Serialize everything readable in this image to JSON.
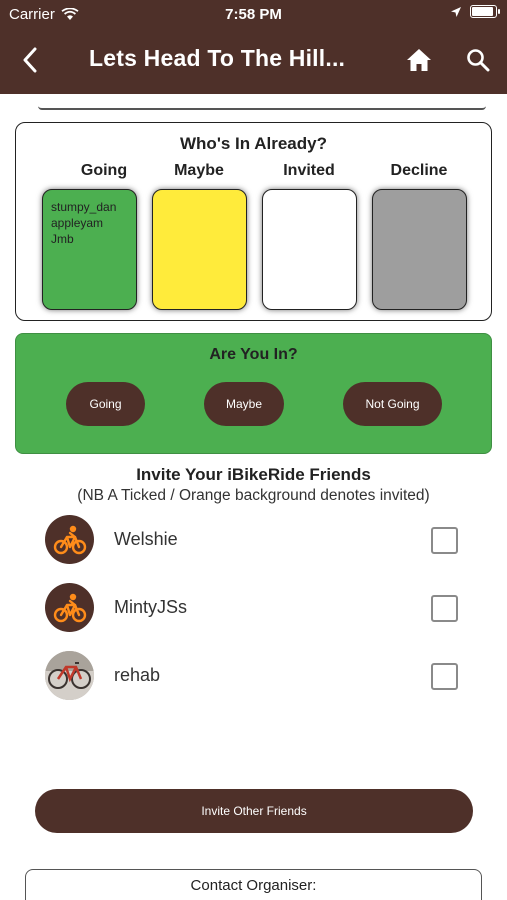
{
  "status_bar": {
    "carrier": "Carrier",
    "time": "7:58 PM"
  },
  "nav": {
    "title": "Lets Head To The Hill..."
  },
  "whos_in": {
    "title": "Who's In Already?",
    "columns": [
      {
        "label": "Going",
        "color": "#4caf50",
        "names": [
          "stumpy_dan",
          "appleyam",
          "Jmb"
        ]
      },
      {
        "label": "Maybe",
        "color": "#ffeb3b",
        "names": []
      },
      {
        "label": "Invited",
        "color": "#ffffff",
        "names": []
      },
      {
        "label": "Decline",
        "color": "#9e9e9e",
        "names": []
      }
    ]
  },
  "are_you_in": {
    "title": "Are You In?",
    "buttons": [
      "Going",
      "Maybe",
      "Not Going"
    ]
  },
  "invite": {
    "title": "Invite Your iBikeRide Friends",
    "note": "(NB A Ticked / Orange background denotes invited)",
    "friends": [
      {
        "name": "Welshie",
        "avatar": "cyclist-icon",
        "checked": false
      },
      {
        "name": "MintyJSs",
        "avatar": "cyclist-icon",
        "checked": false
      },
      {
        "name": "rehab",
        "avatar": "bicycle-photo",
        "checked": false
      }
    ],
    "invite_other_label": "Invite Other Friends"
  },
  "contact": {
    "label": "Contact Organiser:"
  },
  "colors": {
    "brand_brown": "#4e3029",
    "going_green": "#4caf50",
    "maybe_yellow": "#ffeb3b",
    "decline_grey": "#9e9e9e",
    "icon_orange": "#ff8c1a"
  }
}
